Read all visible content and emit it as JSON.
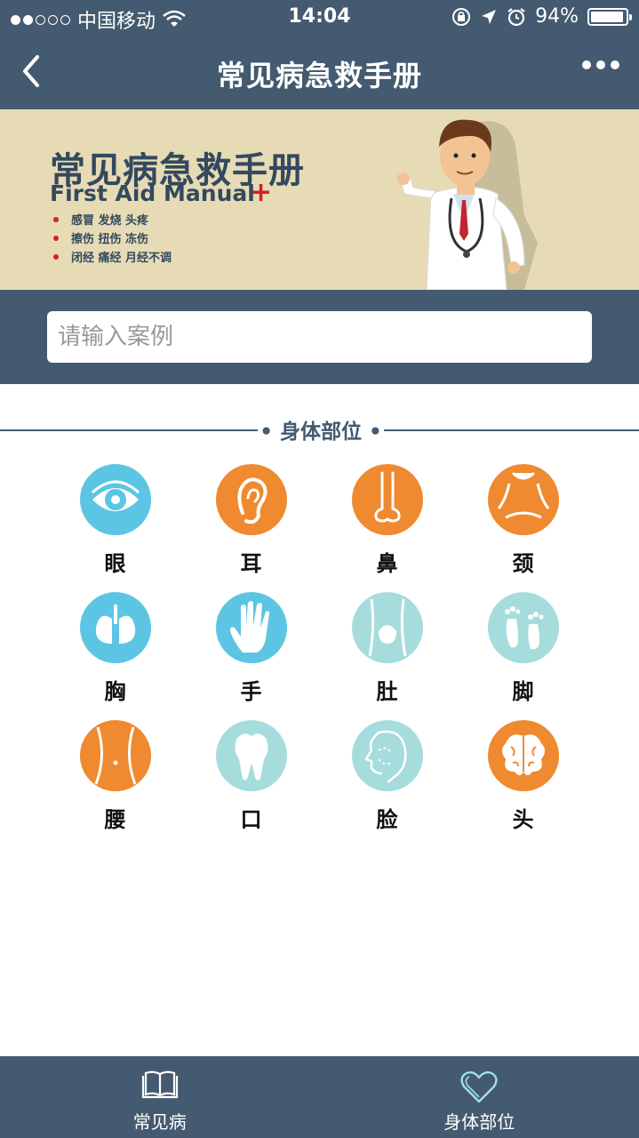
{
  "status_bar": {
    "carrier": "中国移动",
    "time": "14:04",
    "battery": "94%",
    "battery_level": 0.94
  },
  "nav": {
    "title": "常见病急救手册"
  },
  "banner": {
    "title": "常见病急救手册",
    "subtitle": "First Aid Manual",
    "plus": "+",
    "bullets": [
      "感冒 发烧 头疼",
      "擦伤 扭伤 冻伤",
      "闭经 痛经 月经不调"
    ]
  },
  "search": {
    "placeholder": "请输入案例"
  },
  "section": {
    "title": "• 身体部位 •"
  },
  "body_parts": [
    {
      "label": "眼",
      "icon": "eye-icon",
      "color": "#5bc5e3"
    },
    {
      "label": "耳",
      "icon": "ear-icon",
      "color": "#ef8a30"
    },
    {
      "label": "鼻",
      "icon": "nose-icon",
      "color": "#ef8a30"
    },
    {
      "label": "颈",
      "icon": "neck-icon",
      "color": "#ef8a30"
    },
    {
      "label": "胸",
      "icon": "lungs-icon",
      "color": "#5bc5e3"
    },
    {
      "label": "手",
      "icon": "hand-icon",
      "color": "#5bc5e3"
    },
    {
      "label": "肚",
      "icon": "belly-icon",
      "color": "#a6dcdc"
    },
    {
      "label": "脚",
      "icon": "feet-icon",
      "color": "#a6dcdc"
    },
    {
      "label": "腰",
      "icon": "waist-icon",
      "color": "#ef8a30"
    },
    {
      "label": "口",
      "icon": "tooth-icon",
      "color": "#a6dcdc"
    },
    {
      "label": "脸",
      "icon": "face-icon",
      "color": "#a6dcdc"
    },
    {
      "label": "头",
      "icon": "brain-icon",
      "color": "#ef8a30"
    }
  ],
  "tabbar": {
    "tabs": [
      {
        "label": "常见病",
        "icon": "book-icon"
      },
      {
        "label": "身体部位",
        "icon": "heart-icon"
      }
    ]
  },
  "colors": {
    "primary": "#445a70",
    "banner_bg": "#e6dbb5",
    "accent_red": "#d62020",
    "active_tab_icon": "#9fe0ec"
  }
}
